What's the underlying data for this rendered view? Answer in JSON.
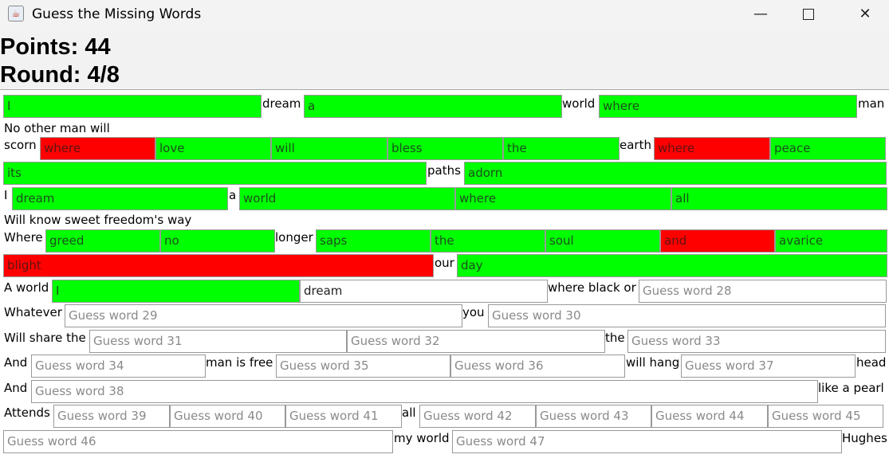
{
  "window": {
    "title": "Guess the Missing Words",
    "minimize": "—",
    "close": "✕",
    "app_icon": "java-cup-icon"
  },
  "score": {
    "points": "Points: 44",
    "round": "Round: 4/8"
  },
  "labels": {
    "l1": "dream",
    "l2": "world",
    "l3": "man",
    "l4": "No other man will",
    "l5": "scorn",
    "l6": "earth",
    "l7": "paths",
    "l8": "I",
    "l9": "a",
    "l10": "Will know sweet freedom's way",
    "l11": "Where",
    "l12": "longer",
    "l13": "our",
    "l14": "A world",
    "l15": "where black or",
    "l16": "Whatever",
    "l17": "you",
    "l18": "Will share the",
    "l19": "the",
    "l20": "And",
    "l21": "man is free",
    "l22": "will hang",
    "l23": "head",
    "l24": "And",
    "l25": "like a pearl",
    "l26": "Attends",
    "l27": "all",
    "l28": "my world",
    "l29": "Hughes"
  },
  "guesses": {
    "g1": "I",
    "g2": "a",
    "g3": "where",
    "g4": "where",
    "g5": "love",
    "g6": "will",
    "g7": "bless",
    "g8": "the",
    "g9": "where",
    "g10": "peace",
    "g11": "its",
    "g12": "adorn",
    "g13": "dream",
    "g14": "world",
    "g15": "where",
    "g16": "all",
    "g17": "greed",
    "g18": "no",
    "g19": "saps",
    "g20": "the",
    "g21": "soul",
    "g22": "and",
    "g23": "avarice",
    "g24": "blight",
    "g25": "day",
    "g26": "I",
    "g27": "dream"
  },
  "placeholders": {
    "p28": "Guess word 28",
    "p29": "Guess word 29",
    "p30": "Guess word 30",
    "p31": "Guess word 31",
    "p32": "Guess word 32",
    "p33": "Guess word 33",
    "p34": "Guess word 34",
    "p35": "Guess word 35",
    "p36": "Guess word 36",
    "p37": "Guess word 37",
    "p38": "Guess word 38",
    "p39": "Guess word 39",
    "p40": "Guess word 40",
    "p41": "Guess word 41",
    "p42": "Guess word 42",
    "p43": "Guess word 43",
    "p44": "Guess word 44",
    "p45": "Guess word 45",
    "p46": "Guess word 46",
    "p47": "Guess word 47"
  },
  "colors": {
    "correct": "#00ff00",
    "wrong": "#ff0000",
    "empty": "#ffffff"
  }
}
